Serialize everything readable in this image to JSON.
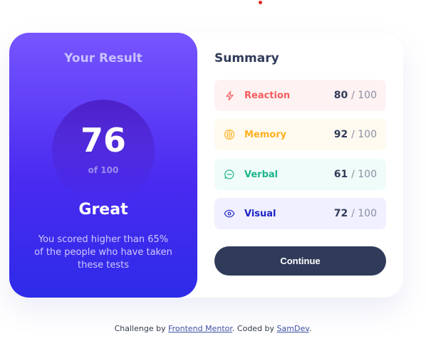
{
  "result": {
    "title": "Your Result",
    "score": "76",
    "score_max_label": "of 100",
    "rating": "Great",
    "description": "You scored higher than 65% of the people who have taken these tests"
  },
  "summary": {
    "title": "Summary",
    "items": [
      {
        "label": "Reaction",
        "score": "80",
        "max": "/ 100",
        "icon": "lightning-icon",
        "color": "#f55d5d",
        "bg": "#fff2f2"
      },
      {
        "label": "Memory",
        "score": "92",
        "max": "/ 100",
        "icon": "brain-icon",
        "color": "#ffb01f",
        "bg": "#fffaf0"
      },
      {
        "label": "Verbal",
        "score": "61",
        "max": "/ 100",
        "icon": "chat-icon",
        "color": "#1db58d",
        "bg": "#f0fcf9"
      },
      {
        "label": "Visual",
        "score": "72",
        "max": "/ 100",
        "icon": "eye-icon",
        "color": "#1d24c5",
        "bg": "#f0f0ff"
      }
    ],
    "continue_label": "Continue"
  },
  "footer": {
    "prefix": "Challenge by ",
    "link1": "Frontend Mentor",
    "middle": ". Coded by ",
    "link2": "SamDev",
    "suffix": "."
  }
}
